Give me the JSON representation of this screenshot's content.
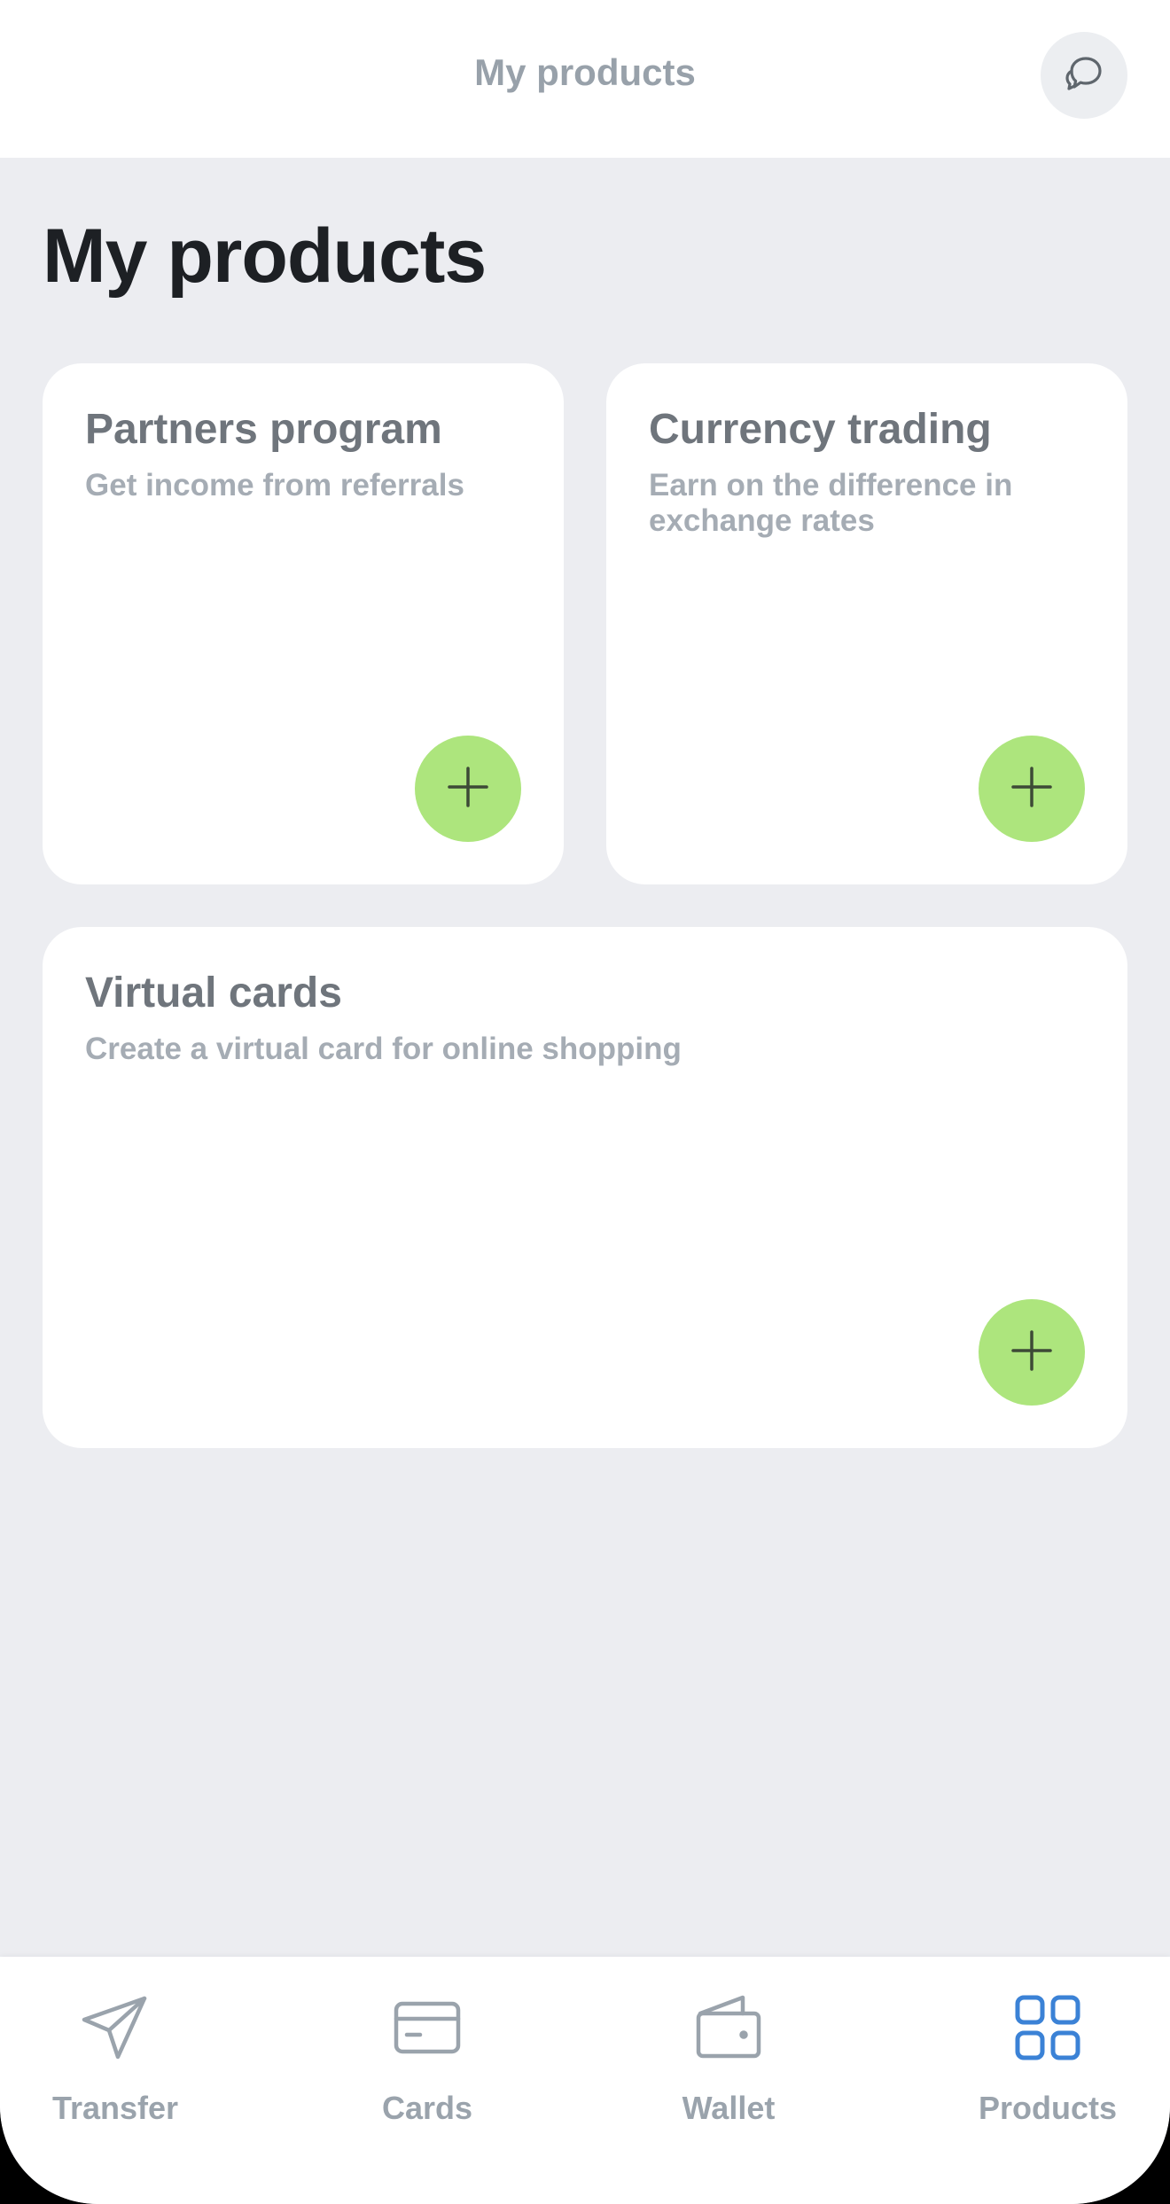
{
  "header": {
    "title": "My products",
    "chat_icon": "chat-icon"
  },
  "page": {
    "title": "My products"
  },
  "products": [
    {
      "title": "Partners program",
      "description": "Get income from referrals",
      "action_icon": "plus-icon"
    },
    {
      "title": "Currency trading",
      "description": "Earn on the difference in exchange rates",
      "action_icon": "plus-icon"
    },
    {
      "title": "Virtual cards",
      "description": "Create a virtual card for online shopping",
      "action_icon": "plus-icon"
    }
  ],
  "nav": {
    "items": [
      {
        "label": "Transfer",
        "icon": "send-icon",
        "active": false
      },
      {
        "label": "Cards",
        "icon": "card-icon",
        "active": false
      },
      {
        "label": "Wallet",
        "icon": "wallet-icon",
        "active": false
      },
      {
        "label": "Products",
        "icon": "grid-icon",
        "active": true
      }
    ]
  },
  "colors": {
    "background": "#ecedf1",
    "accent_green": "#ade57d",
    "active_icon": "#3b82d6",
    "inactive_icon": "#9aa3ac"
  }
}
